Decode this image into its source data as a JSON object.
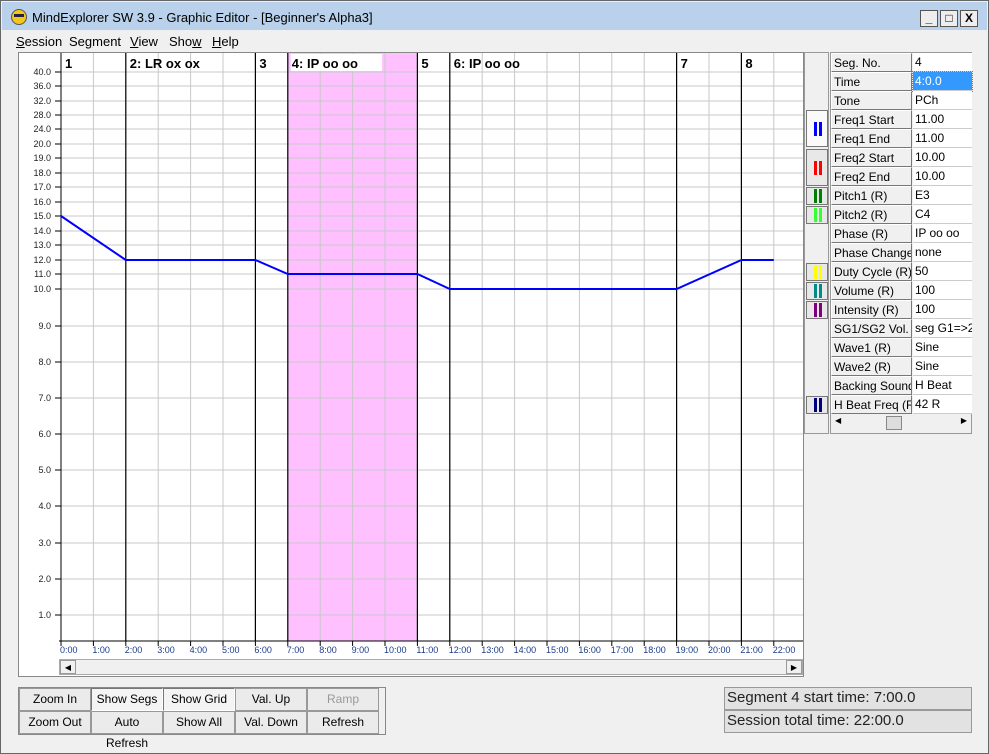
{
  "window": {
    "title": "MindExplorer SW 3.9 - Graphic Editor - [Beginner's Alpha3]",
    "controls": [
      "_",
      "□",
      "X"
    ]
  },
  "menu": [
    {
      "label": "Session",
      "u": "S"
    },
    {
      "label": "Segment",
      "u": "g"
    },
    {
      "label": "View",
      "u": "V"
    },
    {
      "label": "Show",
      "u": "w"
    },
    {
      "label": "Help",
      "u": "H"
    }
  ],
  "chart_data": {
    "type": "line",
    "x_ticks": [
      "0:00",
      "1:00",
      "2:00",
      "3:00",
      "4:00",
      "5:00",
      "6:00",
      "7:00",
      "8:00",
      "9:00",
      "10:00",
      "11:00",
      "12:00",
      "13:00",
      "14:00",
      "15:00",
      "16:00",
      "17:00",
      "18:00",
      "19:00",
      "20:00",
      "21:00",
      "22:00"
    ],
    "y_ticks": [
      40,
      36,
      32,
      28,
      24,
      20,
      19,
      18,
      17,
      16,
      15,
      14,
      13,
      12,
      11,
      10,
      9,
      8,
      7,
      6,
      5,
      4,
      3,
      2,
      1
    ],
    "y_tick_labels": [
      "40.0",
      "36.0",
      "32.0",
      "28.0",
      "24.0",
      "20.0",
      "19.0",
      "18.0",
      "17.0",
      "16.0",
      "15.0",
      "14.0",
      "13.0",
      "12.0",
      "11.0",
      "10.0",
      "9.0",
      "8.0",
      "7.0",
      "6.0",
      "5.0",
      "4.0",
      "3.0",
      "2.0",
      "1.0"
    ],
    "x_unit": "minutes",
    "series": [
      {
        "color": "#0000ff",
        "points": [
          [
            0,
            15
          ],
          [
            2,
            12
          ],
          [
            6,
            12
          ],
          [
            7,
            11
          ],
          [
            11,
            11
          ],
          [
            12,
            10
          ],
          [
            19,
            10
          ],
          [
            21,
            12
          ],
          [
            22,
            12
          ]
        ]
      }
    ],
    "segments": [
      {
        "start": 0,
        "label": "1"
      },
      {
        "start": 2,
        "label": "2: LR ox ox"
      },
      {
        "start": 6,
        "label": "3"
      },
      {
        "start": 7,
        "label": "4: IP oo oo"
      },
      {
        "start": 11,
        "label": "5"
      },
      {
        "start": 12,
        "label": "6: IP oo oo"
      },
      {
        "start": 19,
        "label": "7"
      },
      {
        "start": 21,
        "label": "8"
      }
    ],
    "selected_segment": {
      "start": 7,
      "end": 11,
      "color": "#ffc0ff"
    },
    "grid": true
  },
  "properties": [
    {
      "name": "Seg. No.",
      "value": "4"
    },
    {
      "name": "Time",
      "value": "4:0.0",
      "selected": true
    },
    {
      "name": "Tone",
      "value": "PCh"
    },
    {
      "name": "Freq1 Start",
      "value": "11.00"
    },
    {
      "name": "Freq1 End",
      "value": "11.00"
    },
    {
      "name": "Freq2 Start",
      "value": "10.00"
    },
    {
      "name": "Freq2 End",
      "value": "10.00"
    },
    {
      "name": "Pitch1 (R)",
      "value": "E3"
    },
    {
      "name": "Pitch2 (R)",
      "value": "C4"
    },
    {
      "name": "Phase (R)",
      "value": "IP oo oo"
    },
    {
      "name": "Phase Change",
      "value": "none"
    },
    {
      "name": "Duty Cycle (R)",
      "value": "50"
    },
    {
      "name": "Volume (R)",
      "value": "100"
    },
    {
      "name": "Intensity (R)",
      "value": "100"
    },
    {
      "name": "SG1/SG2 Vol.",
      "value": "seg G1=>2"
    },
    {
      "name": "Wave1 (R)",
      "value": "Sine"
    },
    {
      "name": "Wave2 (R)",
      "value": "Sine"
    },
    {
      "name": "Backing Sound",
      "value": "H Beat"
    },
    {
      "name": "H Beat Freq (R)",
      "value": "42 R"
    }
  ],
  "toggles": [
    {
      "name": "freq1",
      "color": "#0000ff",
      "active": true
    },
    {
      "name": "freq2",
      "color": "#ff0000"
    },
    {
      "name": "pitch1",
      "color": "#008000"
    },
    {
      "name": "pitch2",
      "color": "#33ff33"
    },
    {
      "name": "duty-cycle",
      "color": "#ffff00"
    },
    {
      "name": "volume",
      "color": "#008b8b"
    },
    {
      "name": "intensity",
      "color": "#800080"
    },
    {
      "name": "h-beat-freq",
      "color": "#000080"
    }
  ],
  "buttons": [
    [
      "Zoom In",
      "Zoom Out"
    ],
    [
      "Show Segs",
      "Auto Refresh"
    ],
    [
      "Show Grid",
      "Show All"
    ],
    [
      "Val. Up",
      "Val. Down"
    ],
    [
      "Ramp",
      "Refresh"
    ]
  ],
  "status": {
    "segment_start": "Segment 4 start time: 7:00.0",
    "total_time": "Session total time: 22:00.0"
  }
}
